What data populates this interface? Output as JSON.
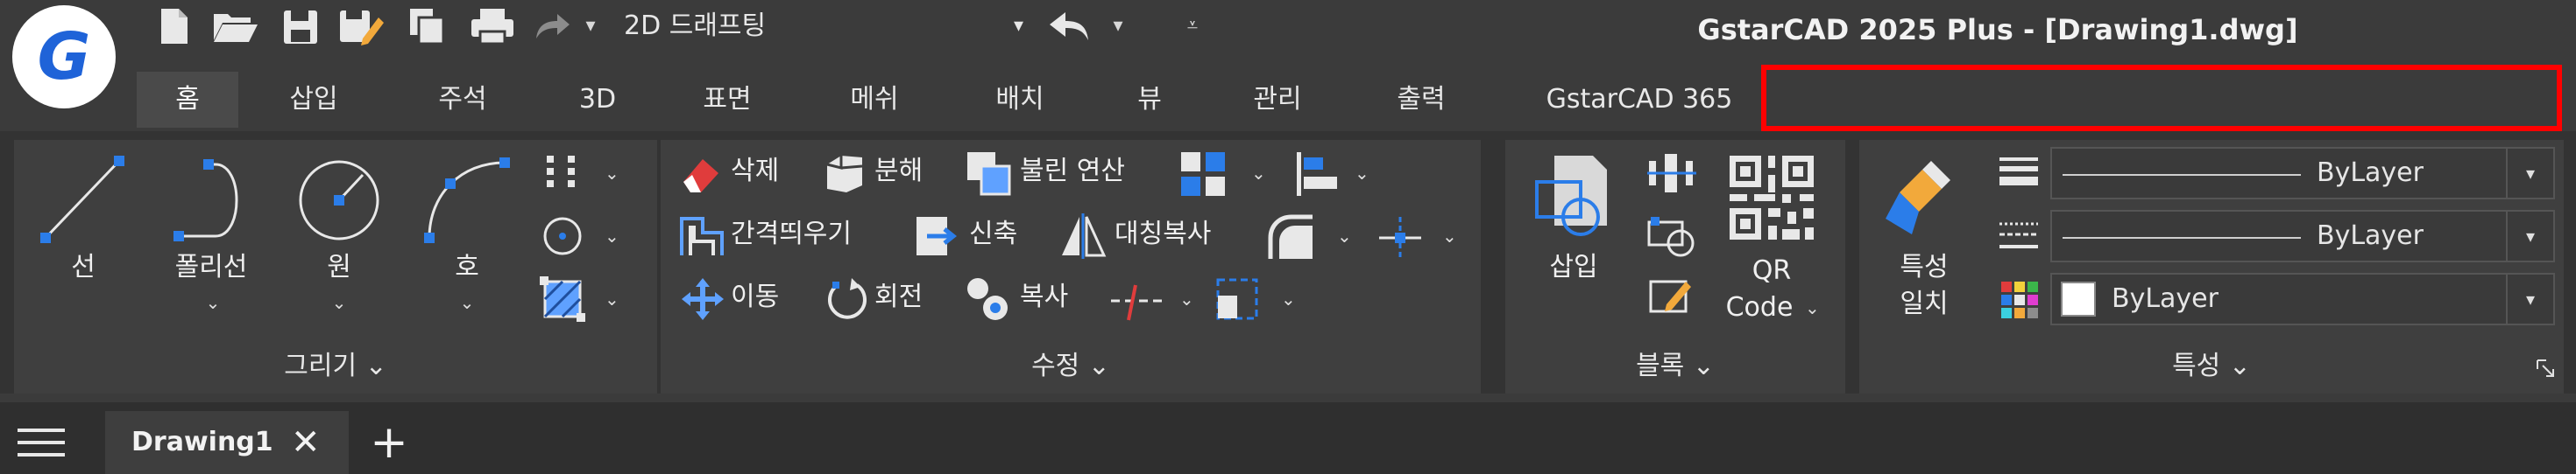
{
  "app": {
    "title": "GstarCAD 2025 Plus - [Drawing1.dwg]",
    "logo_letter": "G",
    "brand_color": "#1f63d8",
    "highlight_color": "#ff0000"
  },
  "quick_access": {
    "workspace": "2D 드래프팅",
    "workspace_arrow": "▾",
    "undo_arrow": "▾",
    "more_arrow": "⩡",
    "icons": [
      "new-file-icon",
      "open-folder-icon",
      "save-icon",
      "save-as-icon",
      "copy-icon",
      "print-icon",
      "redo-icon",
      "undo-icon"
    ]
  },
  "tabs": [
    {
      "label": "홈",
      "active": true
    },
    {
      "label": "삽입"
    },
    {
      "label": "주석"
    },
    {
      "label": "3D"
    },
    {
      "label": "표면"
    },
    {
      "label": "메쉬"
    },
    {
      "label": "배치"
    },
    {
      "label": "뷰"
    },
    {
      "label": "관리"
    },
    {
      "label": "출력"
    },
    {
      "label": "GstarCAD 365"
    }
  ],
  "panels": {
    "draw": {
      "title": "그리기 ⌄",
      "buttons": [
        {
          "label": "선"
        },
        {
          "label": "폴리선"
        },
        {
          "label": "원"
        },
        {
          "label": "호"
        }
      ],
      "chev": "⌄"
    },
    "modify": {
      "title": "수정 ⌄",
      "row1": [
        "삭제",
        "분해",
        "불린 연산"
      ],
      "row2": [
        "간격띄우기",
        "신축",
        "대칭복사"
      ],
      "row3": [
        "이동",
        "회전",
        "복사"
      ]
    },
    "block": {
      "title": "블록 ⌄",
      "insert": "삽입",
      "qr_line1": "QR",
      "qr_line2": "Code"
    },
    "properties": {
      "title": "특성 ⌄",
      "match_line1": "특성",
      "match_line2": "일치",
      "linetype": "ByLayer",
      "lineweight": "ByLayer",
      "color": "ByLayer",
      "color_swatch": "#ffffff"
    }
  },
  "documents": {
    "tab": "Drawing1",
    "close": "✕",
    "add": "+"
  }
}
